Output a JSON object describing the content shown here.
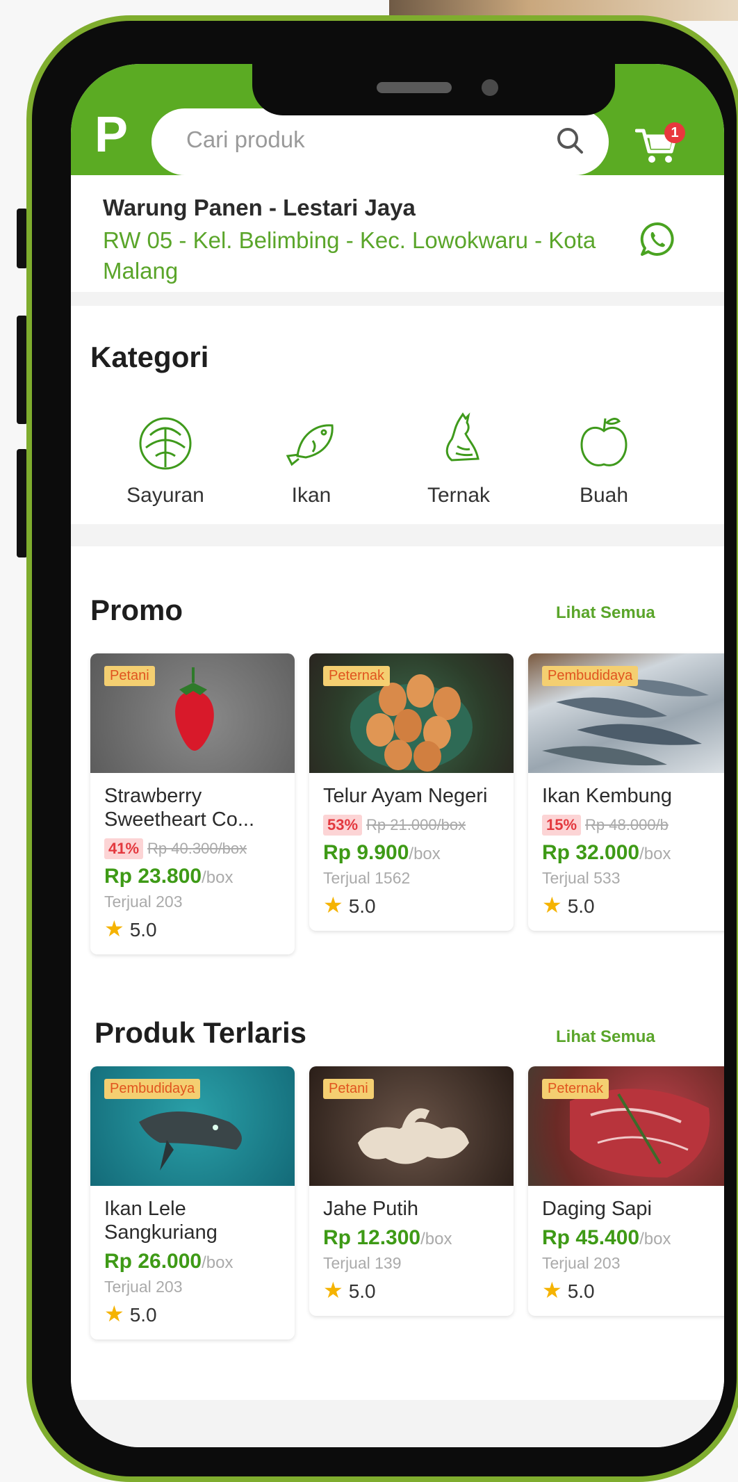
{
  "header": {
    "logo": "P",
    "search_placeholder": "Cari produk",
    "cart_count": "1",
    "accent_color": "#5bab23"
  },
  "store": {
    "name": "Warung Panen - Lestari Jaya",
    "address": "RW 05 - Kel. Belimbing - Kec. Lowokwaru - Kota Malang"
  },
  "kategori": {
    "title": "Kategori",
    "items": [
      {
        "label": "Sayuran",
        "icon": "cabbage-icon"
      },
      {
        "label": "Ikan",
        "icon": "fish-icon"
      },
      {
        "label": "Ternak",
        "icon": "chicken-icon"
      },
      {
        "label": "Buah",
        "icon": "apple-icon"
      }
    ]
  },
  "promo": {
    "title": "Promo",
    "see_all": "Lihat Semua",
    "products": [
      {
        "tag": "Petani",
        "name": "Strawberry Sweetheart Co...",
        "discount": "41%",
        "old_price": "Rp 40.300/box",
        "price": "Rp 23.800",
        "unit": "/box",
        "sold": "Terjual 203",
        "rating": "5.0"
      },
      {
        "tag": "Peternak",
        "name": "Telur Ayam Negeri",
        "discount": "53%",
        "old_price": "Rp 21.000/box",
        "price": "Rp 9.900",
        "unit": "/box",
        "sold": "Terjual 1562",
        "rating": "5.0"
      },
      {
        "tag": "Pembudidaya",
        "name": "Ikan Kembung",
        "discount": "15%",
        "old_price": "Rp 48.000/b",
        "price": "Rp 32.000",
        "unit": "/box",
        "sold": "Terjual 533",
        "rating": "5.0"
      }
    ]
  },
  "terlaris": {
    "title": "Produk Terlaris",
    "see_all": "Lihat Semua",
    "products": [
      {
        "tag": "Pembudidaya",
        "name": "Ikan Lele Sangkuriang",
        "price": "Rp 26.000",
        "unit": "/box",
        "sold": "Terjual 203",
        "rating": "5.0"
      },
      {
        "tag": "Petani",
        "name": "Jahe Putih",
        "price": "Rp 12.300",
        "unit": "/box",
        "sold": "Terjual 139",
        "rating": "5.0"
      },
      {
        "tag": "Peternak",
        "name": "Daging Sapi",
        "price": "Rp 45.400",
        "unit": "/box",
        "sold": "Terjual 203",
        "rating": "5.0"
      }
    ]
  }
}
